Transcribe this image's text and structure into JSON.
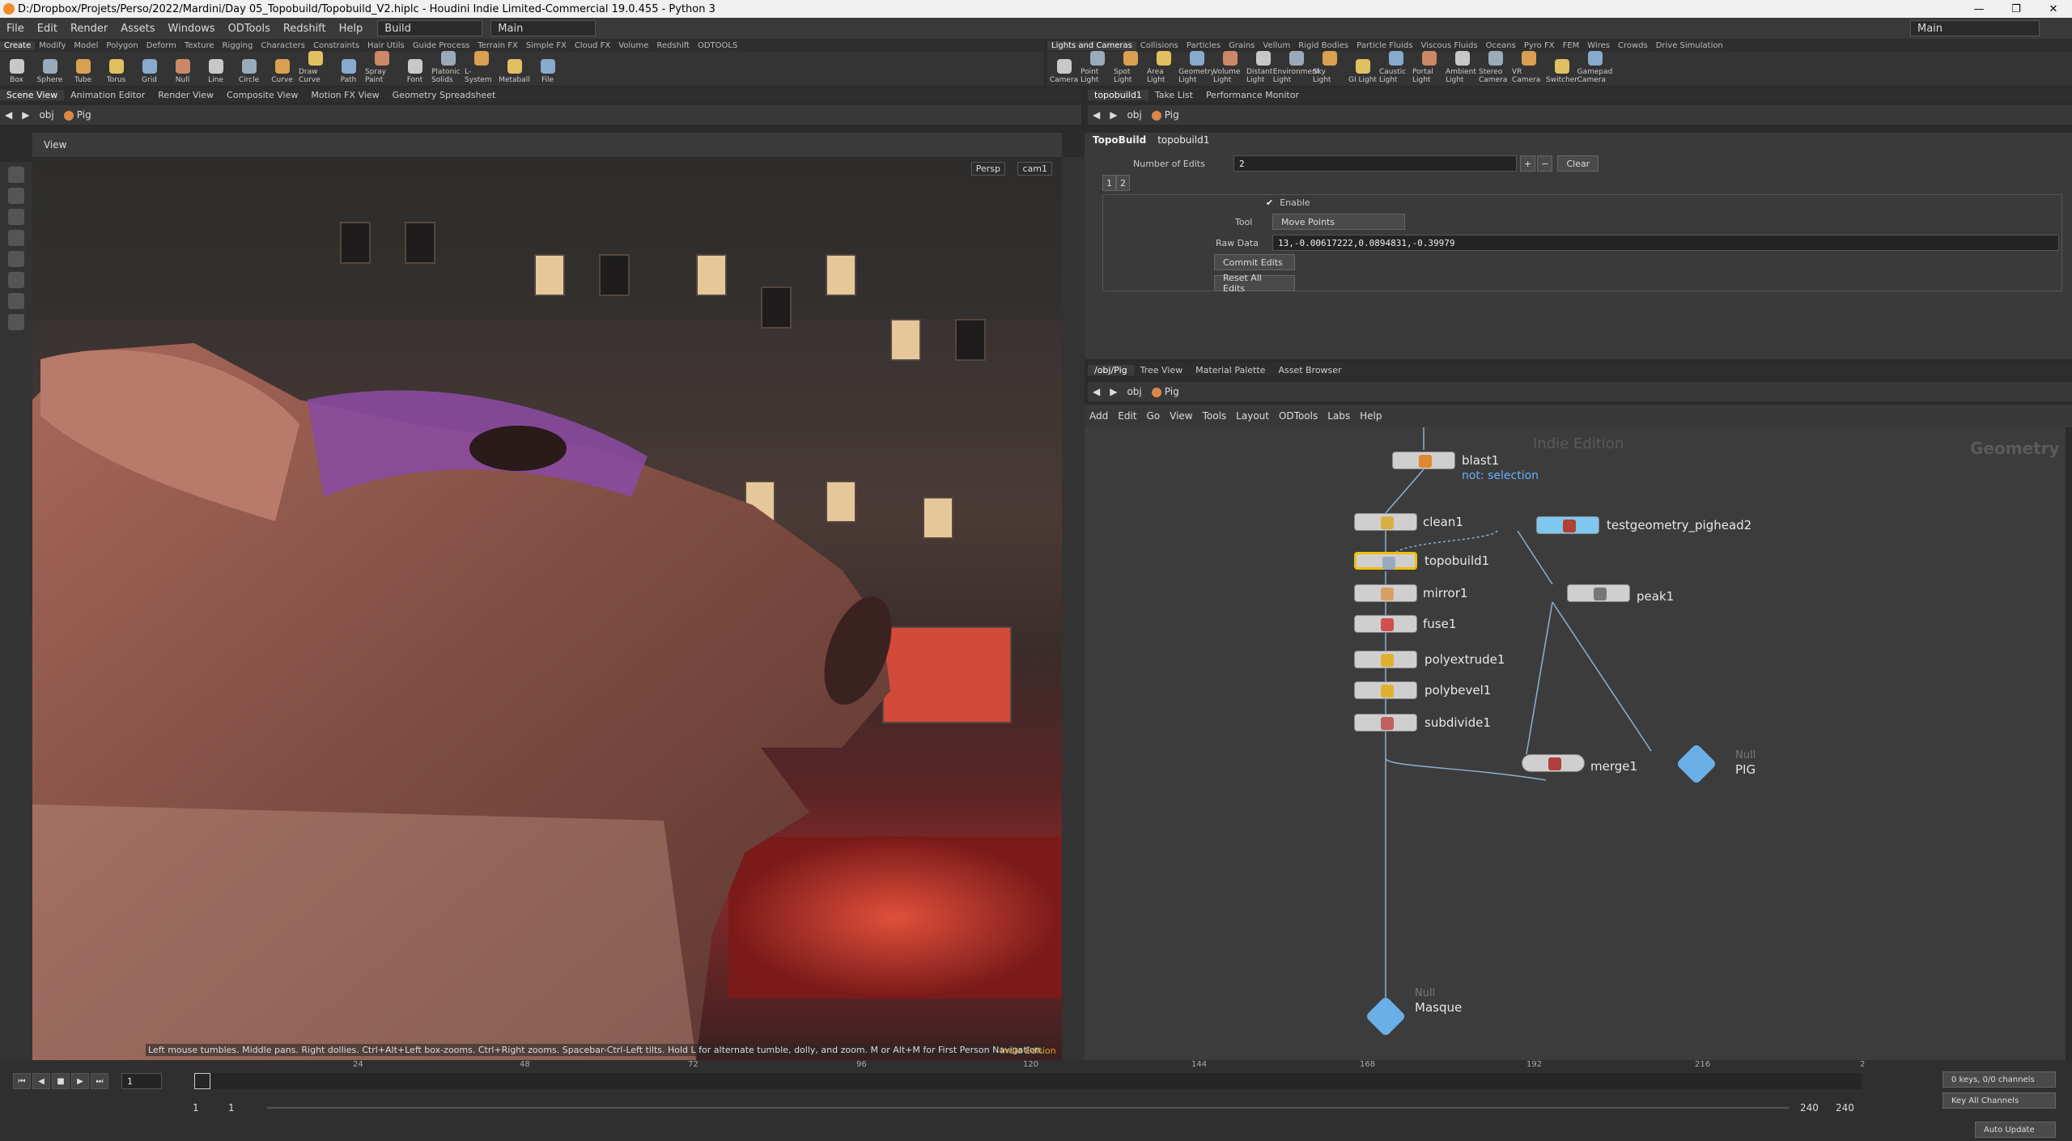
{
  "window": {
    "title": "D:/Dropbox/Projets/Perso/2022/Mardini/Day 05_Topobuild/Topobuild_V2.hiplc - Houdini Indie Limited-Commercial 19.0.455 - Python 3",
    "controls": [
      "—",
      "❐",
      "✕"
    ]
  },
  "menu": [
    "File",
    "Edit",
    "Render",
    "Assets",
    "Windows",
    "ODTools",
    "Redshift",
    "Help"
  ],
  "desktop": {
    "build": "Build",
    "main": "Main",
    "right_main": "Main"
  },
  "shelf_left": {
    "tabs": [
      "Create",
      "Modify",
      "Model",
      "Polygon",
      "Deform",
      "Texture",
      "Rigging",
      "Characters",
      "Constraints",
      "Hair Utils",
      "Guide Process",
      "Terrain FX",
      "Simple FX",
      "Cloud FX",
      "Volume",
      "Redshift",
      "ODTOOLS"
    ],
    "tools": [
      "Box",
      "Sphere",
      "Tube",
      "Torus",
      "Grid",
      "Null",
      "Line",
      "Circle",
      "Curve",
      "Draw Curve",
      "Path",
      "Spray Paint",
      "Font",
      "Platonic Solids",
      "L-System",
      "Metaball",
      "File"
    ]
  },
  "shelf_right": {
    "tabs": [
      "Lights and Cameras",
      "Collisions",
      "Particles",
      "Grains",
      "Vellum",
      "Rigid Bodies",
      "Particle Fluids",
      "Viscous Fluids",
      "Oceans",
      "Pyro FX",
      "FEM",
      "Wires",
      "Crowds",
      "Drive Simulation"
    ],
    "tools": [
      "Camera",
      "Point Light",
      "Spot Light",
      "Area Light",
      "Geometry Light",
      "Volume Light",
      "Distant Light",
      "Environment Light",
      "Sky Light",
      "GI Light",
      "Caustic Light",
      "Portal Light",
      "Ambient Light",
      "Stereo Camera",
      "VR Camera",
      "Switcher",
      "Gamepad Camera"
    ]
  },
  "left_pane": {
    "tabs": [
      "Scene View",
      "Animation Editor",
      "Render View",
      "Composite View",
      "Motion FX View",
      "Geometry Spreadsheet"
    ],
    "path": [
      "obj",
      "Pig"
    ],
    "view_label": "View",
    "persp": "Persp",
    "cam": "cam1",
    "hint": "Left mouse tumbles. Middle pans. Right dollies. Ctrl+Alt+Left box-zooms. Ctrl+Right zooms. Spacebar-Ctrl-Left tilts. Hold L for alternate tumble, dolly, and zoom.    M or Alt+M for First Person Navigation.",
    "edition": "Indie Edition"
  },
  "parm_pane": {
    "tabs": [
      "topobuild1",
      "Take List",
      "Performance Monitor"
    ],
    "path": [
      "obj",
      "Pig"
    ],
    "node_type": "TopoBuild",
    "node_name": "topobuild1",
    "num_edits_label": "Number of Edits",
    "num_edits": "2",
    "clear": "Clear",
    "multi_tabs": [
      "1",
      "2"
    ],
    "enable": "Enable",
    "tool_label": "Tool",
    "tool_value": "Move Points",
    "raw_label": "Raw Data",
    "raw_value": "13,-0.00617222,0.0894831,-0.39979",
    "commit": "Commit Edits",
    "reset": "Reset All Edits"
  },
  "net_pane": {
    "tabs": [
      "/obj/Pig",
      "Tree View",
      "Material Palette",
      "Asset Browser"
    ],
    "path": [
      "obj",
      "Pig"
    ],
    "menu": [
      "Add",
      "Edit",
      "Go",
      "View",
      "Tools",
      "Layout",
      "ODTools",
      "Labs",
      "Help"
    ],
    "watermark_edition": "Indie Edition",
    "watermark_context": "Geometry",
    "nodes": {
      "blast": "blast1",
      "blast_sub": "not: selection",
      "clean": "clean1",
      "testgeo": "testgeometry_pighead2",
      "topo": "topobuild1",
      "mirror": "mirror1",
      "peak": "peak1",
      "fuse": "fuse1",
      "polyextrude": "polyextrude1",
      "polybevel": "polybevel1",
      "subdivide": "subdivide1",
      "null_pig_type": "Null",
      "null_pig": "PIG",
      "null_masque_type": "Null",
      "null_masque": "Masque",
      "merge": "merge1"
    }
  },
  "timeline": {
    "frame": "1",
    "ticks": [
      "24",
      "48",
      "72",
      "96",
      "120",
      "144",
      "168",
      "192",
      "216",
      "2"
    ],
    "start": "1",
    "start2": "1",
    "end": "240",
    "end2": "240",
    "keys": "0 keys, 0/0 channels",
    "key_all": "Key All Channels",
    "auto_update": "Auto Update"
  }
}
